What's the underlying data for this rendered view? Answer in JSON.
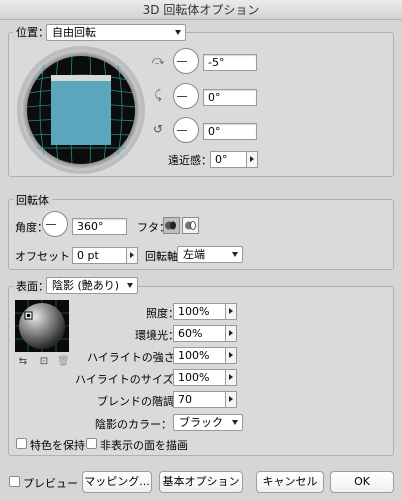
{
  "window": {
    "title": "3D 回転体オプション"
  },
  "position": {
    "label": "位置：",
    "preset": "自由回転",
    "x_angle": "-5°",
    "y_angle": "0°",
    "z_angle": "0°",
    "perspective_label": "遠近感：",
    "perspective": "0°"
  },
  "revolve": {
    "group_label": "回転体",
    "angle_label": "角度：",
    "angle": "360°",
    "cap_label": "フタ：",
    "offset_label": "オフセット：",
    "offset": "0 pt",
    "axis_label": "回転軸",
    "axis": "左端"
  },
  "surface": {
    "label": "表面：",
    "preset": "陰影 (艶あり)",
    "light_intensity_label": "照度：",
    "light_intensity": "100%",
    "ambient_label": "環境光：",
    "ambient": "60%",
    "highlight_intensity_label": "ハイライトの強さ：",
    "highlight_intensity": "100%",
    "highlight_size_label": "ハイライトのサイズ：",
    "highlight_size": "100%",
    "blend_steps_label": "ブレンドの階調：",
    "blend_steps": "70",
    "shading_color_label": "陰影のカラー：",
    "shading_color": "ブラック",
    "preserve_spot_label": "特色を保持",
    "draw_hidden_label": "非表示の面を描画"
  },
  "footer": {
    "preview_label": "プレビュー",
    "mapping_label": "マッピング...",
    "basic_options_label": "基本オプション",
    "cancel_label": "キャンセル",
    "ok_label": "OK"
  }
}
